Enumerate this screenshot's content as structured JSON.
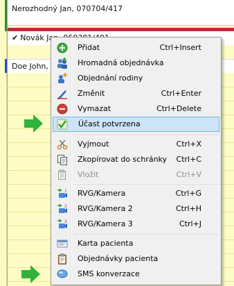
{
  "background": {
    "appointments": [
      {
        "text": "Nerozhodný Jan, 070704/417"
      },
      {
        "text": "Novák Jan, 060301/491",
        "checked": true
      },
      {
        "text": "Doe John, C"
      }
    ]
  },
  "menu": {
    "items": [
      {
        "label": "Přidat",
        "shortcut": "Ctrl+Insert",
        "icon": "add-icon"
      },
      {
        "label": "Hromadná objednávka",
        "shortcut": "",
        "icon": "group-order-icon"
      },
      {
        "label": "Objednání rodiny",
        "shortcut": "",
        "icon": "family-order-icon"
      },
      {
        "label": "Změnit",
        "shortcut": "Ctrl+Enter",
        "icon": "edit-icon"
      },
      {
        "label": "Vymazat",
        "shortcut": "Ctrl+Delete",
        "icon": "delete-icon"
      },
      {
        "label": "Účast potvrzena",
        "shortcut": "",
        "icon": "confirm-check-icon",
        "highlighted": true
      },
      {
        "label": "Vyjmout",
        "shortcut": "Ctrl+X",
        "icon": "cut-icon"
      },
      {
        "label": "Zkopírovat do schránky",
        "shortcut": "Ctrl+C",
        "icon": "copy-icon"
      },
      {
        "label": "Vložit",
        "shortcut": "Ctrl+V",
        "icon": "paste-icon",
        "disabled": true
      },
      {
        "label": "RVG/Kamera",
        "shortcut": "Ctrl+G",
        "icon": "rvg-camera-1-icon"
      },
      {
        "label": "RVG/Kamera 2",
        "shortcut": "Ctrl+H",
        "icon": "rvg-camera-2-icon"
      },
      {
        "label": "RVG/Kamera 3",
        "shortcut": "Ctrl+J",
        "icon": "rvg-camera-3-icon"
      },
      {
        "label": "Karta pacienta",
        "shortcut": "",
        "icon": "patient-card-icon"
      },
      {
        "label": "Objednávky pacienta",
        "shortcut": "",
        "icon": "patient-orders-icon"
      },
      {
        "label": "SMS konverzace",
        "shortcut": "",
        "icon": "sms-bubble-icon"
      }
    ]
  },
  "colors": {
    "highlight": "#cce4f7",
    "arrow": "#2fb33a",
    "menu_bg": "#f0f0f0"
  }
}
